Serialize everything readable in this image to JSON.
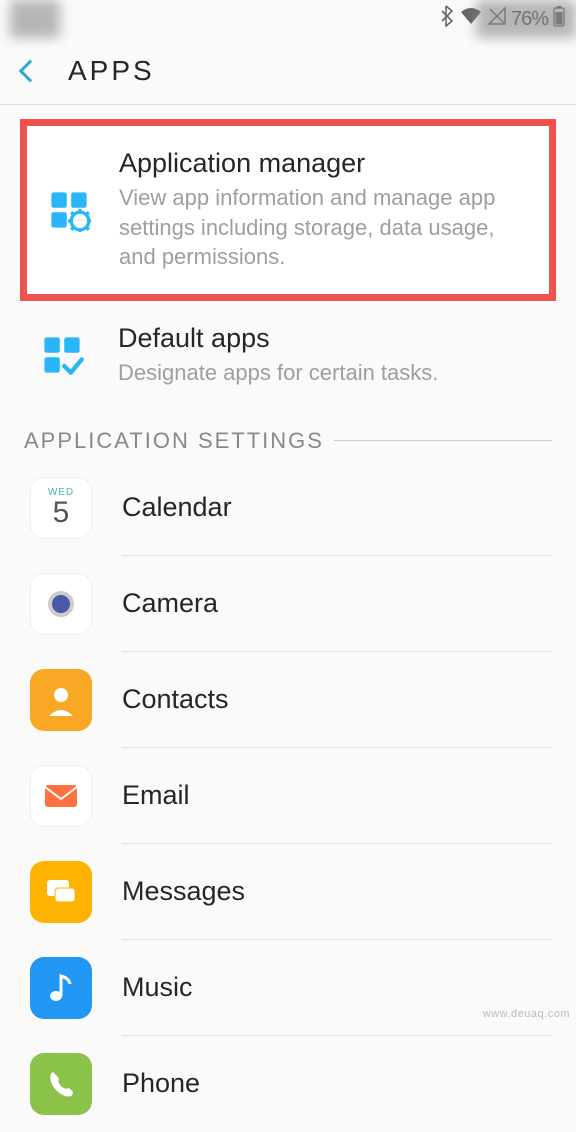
{
  "status_bar": {
    "battery_percent": "76%"
  },
  "header": {
    "title": "APPS"
  },
  "top_entries": [
    {
      "key": "app_manager",
      "title": "Application manager",
      "description": "View app information and manage app settings including storage, data usage, and permissions.",
      "icon": "grid-gear-icon",
      "highlighted": true
    },
    {
      "key": "default_apps",
      "title": "Default apps",
      "description": "Designate apps for certain tasks.",
      "icon": "grid-check-icon",
      "highlighted": false
    }
  ],
  "section": {
    "title": "APPLICATION SETTINGS"
  },
  "apps": [
    {
      "label": "Calendar",
      "icon": "calendar-icon",
      "cal_weekday": "WED",
      "cal_day": "5"
    },
    {
      "label": "Camera",
      "icon": "camera-icon"
    },
    {
      "label": "Contacts",
      "icon": "contacts-icon"
    },
    {
      "label": "Email",
      "icon": "email-icon"
    },
    {
      "label": "Messages",
      "icon": "messages-icon"
    },
    {
      "label": "Music",
      "icon": "music-icon"
    },
    {
      "label": "Phone",
      "icon": "phone-icon"
    }
  ],
  "watermark": "www.deuaq.com"
}
